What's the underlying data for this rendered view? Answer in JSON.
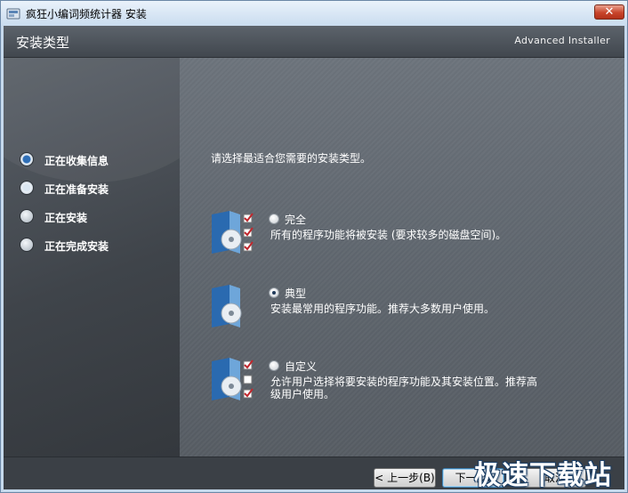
{
  "window": {
    "title": "疯狂小编词频统计器 安装",
    "close_glyph": "✕"
  },
  "header": {
    "title": "安装类型",
    "brand": "Advanced Installer"
  },
  "steps": [
    {
      "label": "正在收集信息",
      "state": "current"
    },
    {
      "label": "正在准备安装",
      "state": "next"
    },
    {
      "label": "正在安装",
      "state": "pending"
    },
    {
      "label": "正在完成安装",
      "state": "pending"
    }
  ],
  "main": {
    "prompt": "请选择最适合您需要的安装类型。",
    "options": [
      {
        "label": "完全",
        "description": "所有的程序功能将被安装 (要求较多的磁盘空间)。",
        "selected": false,
        "icon": "full-install-icon"
      },
      {
        "label": "典型",
        "description": "安装最常用的程序功能。推荐大多数用户使用。",
        "selected": true,
        "icon": "typical-install-icon"
      },
      {
        "label": "自定义",
        "description": "允许用户选择将要安装的程序功能及其安装位置。推荐高级用户使用。",
        "selected": false,
        "icon": "custom-install-icon"
      }
    ]
  },
  "footer": {
    "back_label": "< 上一步(B)",
    "next_label": "下一步(",
    "cancel_label": "取消"
  },
  "watermark": "极速下载站",
  "colors": {
    "accent": "#2f6fb7",
    "checkmark": "#c0272d"
  }
}
